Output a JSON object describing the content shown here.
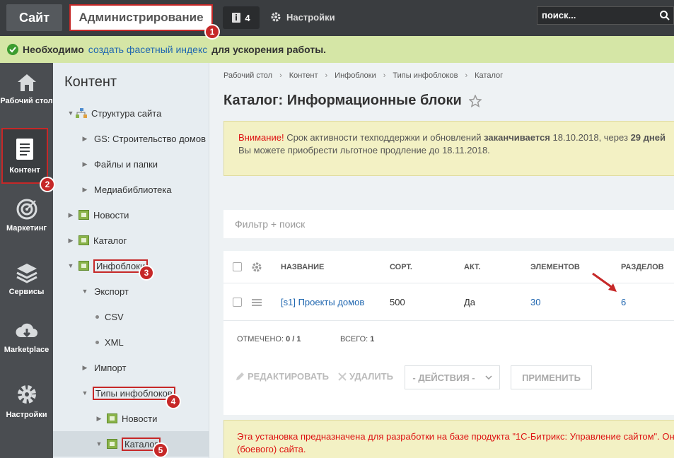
{
  "topbar": {
    "site_label": "Сайт",
    "admin_label": "Администрирование",
    "notifications_count": "4",
    "settings_label": "Настройки",
    "search_placeholder": "поиск..."
  },
  "notice": {
    "prefix": "Необходимо",
    "link": "создать фасетный индекс",
    "suffix": "для ускорения работы."
  },
  "left_menu": [
    {
      "label": "Рабочий стол",
      "icon": "home-icon"
    },
    {
      "label": "Контент",
      "icon": "document-icon"
    },
    {
      "label": "Маркетинг",
      "icon": "target-icon"
    },
    {
      "label": "Сервисы",
      "icon": "layers-icon"
    },
    {
      "label": "Marketplace",
      "icon": "cloud-download-icon"
    },
    {
      "label": "Настройки",
      "icon": "gear-icon"
    }
  ],
  "tree": {
    "title": "Контент",
    "items": [
      "Структура сайта",
      "GS: Строительство домов",
      "Файлы и папки",
      "Медиабиблиотека",
      "Новости",
      "Каталог",
      "Инфоблоки",
      "Экспорт",
      "CSV",
      "XML",
      "Импорт",
      "Типы инфоблоков",
      "Новости",
      "Каталог"
    ]
  },
  "breadcrumb": [
    "Рабочий стол",
    "Контент",
    "Инфоблоки",
    "Типы инфоблоков",
    "Каталог"
  ],
  "page_title": "Каталог: Информационные блоки",
  "warning": {
    "attention": "Внимание!",
    "text1": "Срок активности техподдержки и обновлений",
    "bold1": "заканчивается",
    "text2": "18.10.2018, через",
    "bold2": "29 дней",
    "line2": "Вы можете приобрести льготное продление до 18.11.2018."
  },
  "filter_placeholder": "Фильтр + поиск",
  "grid": {
    "headers": [
      "НАЗВАНИЕ",
      "СОРТ.",
      "АКТ.",
      "ЭЛЕМЕНТОВ",
      "РАЗДЕЛОВ"
    ],
    "rows": [
      {
        "name": "[s1] Проекты домов",
        "sort": "500",
        "active": "Да",
        "elements": "30",
        "sections": "6"
      }
    ],
    "marked_label": "ОТМЕЧЕНО:",
    "marked_value": "0 / 1",
    "total_label": "ВСЕГО:",
    "total_value": "1"
  },
  "actions": {
    "edit": "РЕДАКТИРОВАТЬ",
    "delete": "УДАЛИТЬ",
    "select": "- ДЕЙСТВИЯ -",
    "apply": "ПРИМЕНИТЬ"
  },
  "bottom_notice": {
    "line1": "Эта установка предназначена для разработки на базе продукта \"1С-Битрикс: Управление сайтом\". Он",
    "line2": "(боевого) сайта."
  },
  "annotations": [
    "1",
    "2",
    "3",
    "4",
    "5"
  ],
  "colors": {
    "accent_red": "#c62828",
    "link_blue": "#2067b0",
    "notice_green": "#d5e6a6"
  }
}
